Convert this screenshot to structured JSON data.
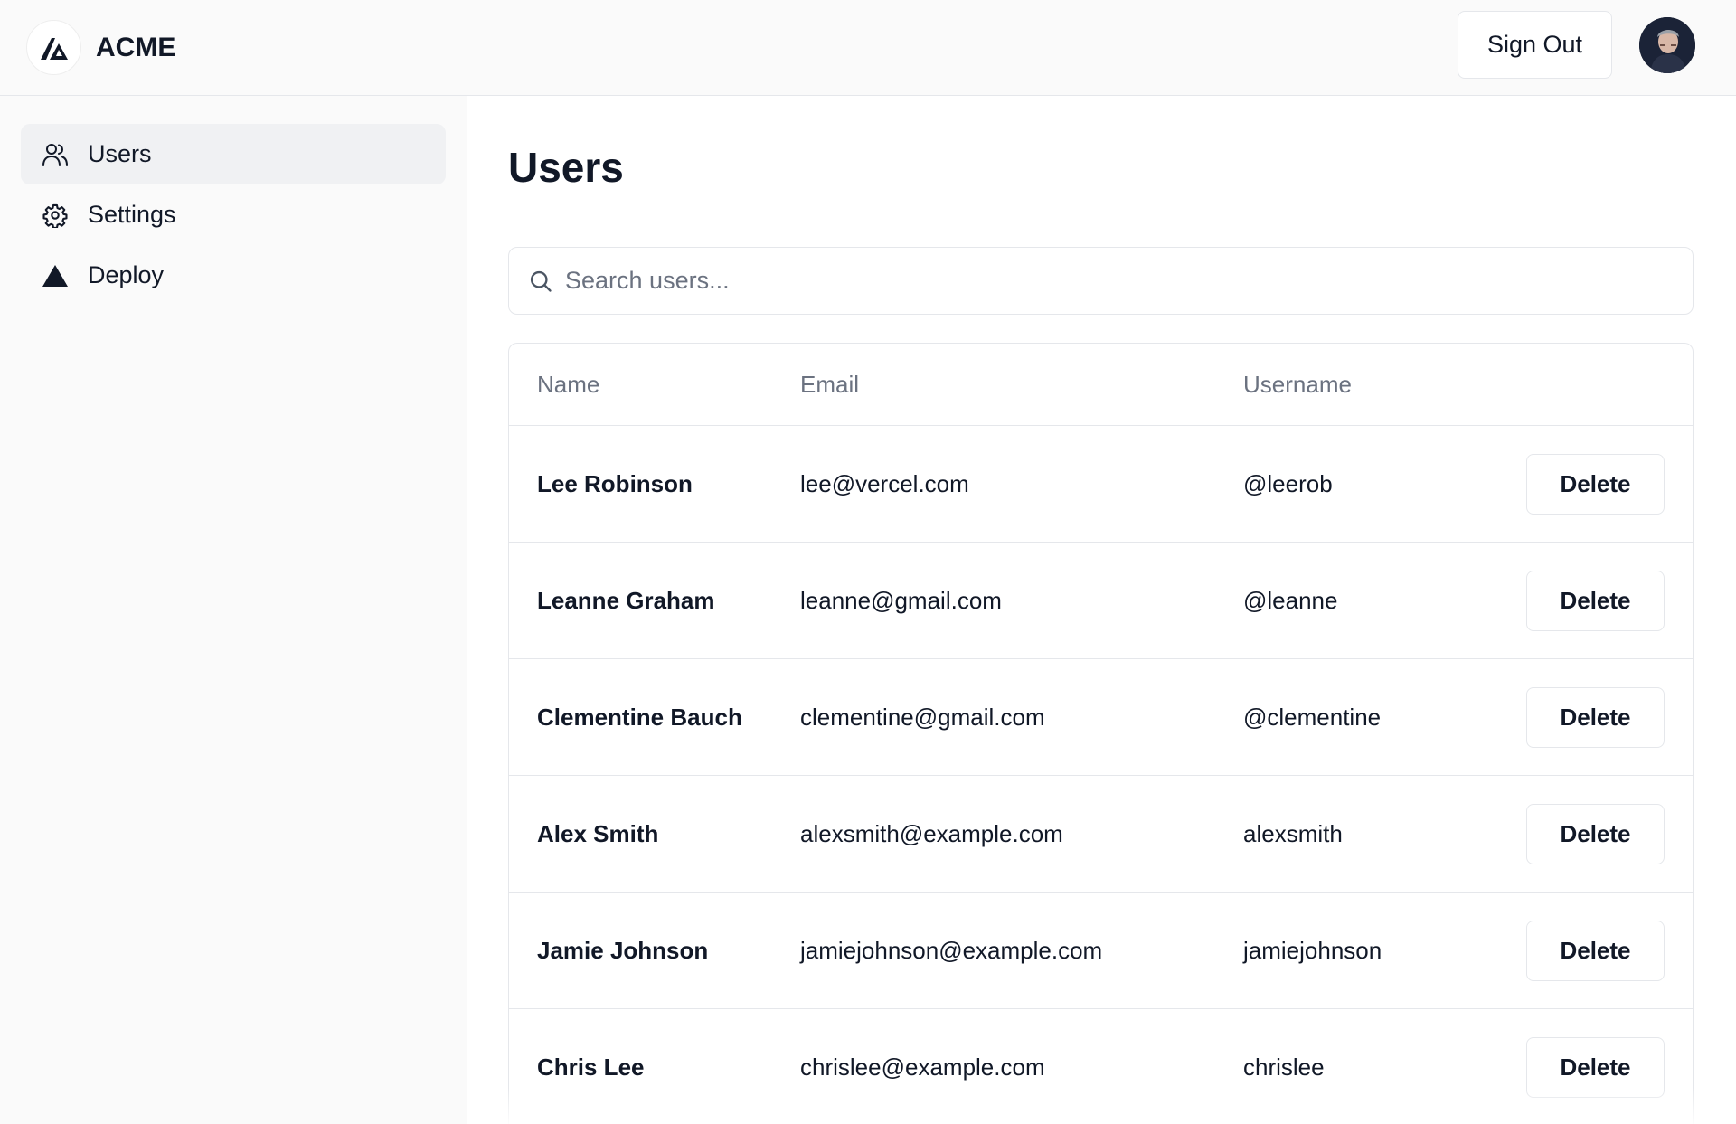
{
  "brand": {
    "name": "ACME",
    "logo_icon": "acme-logo-icon"
  },
  "sidebar": {
    "items": [
      {
        "label": "Users",
        "icon": "users-icon",
        "active": true
      },
      {
        "label": "Settings",
        "icon": "gear-icon",
        "active": false
      },
      {
        "label": "Deploy",
        "icon": "triangle-icon",
        "active": false
      }
    ]
  },
  "header": {
    "sign_out_label": "Sign Out",
    "avatar_icon": "user-avatar"
  },
  "main": {
    "title": "Users",
    "search": {
      "placeholder": "Search users...",
      "value": ""
    },
    "table": {
      "columns": [
        "Name",
        "Email",
        "Username",
        ""
      ],
      "rows": [
        {
          "name": "Lee Robinson",
          "email": "lee@vercel.com",
          "username": "@leerob",
          "action": "Delete"
        },
        {
          "name": "Leanne Graham",
          "email": "leanne@gmail.com",
          "username": "@leanne",
          "action": "Delete"
        },
        {
          "name": "Clementine Bauch",
          "email": "clementine@gmail.com",
          "username": "@clementine",
          "action": "Delete"
        },
        {
          "name": "Alex Smith",
          "email": "alexsmith@example.com",
          "username": "alexsmith",
          "action": "Delete"
        },
        {
          "name": "Jamie Johnson",
          "email": "jamiejohnson@example.com",
          "username": "jamiejohnson",
          "action": "Delete"
        },
        {
          "name": "Chris Lee",
          "email": "chrislee@example.com",
          "username": "chrislee",
          "action": "Delete"
        }
      ]
    }
  },
  "colors": {
    "text": "#111827",
    "muted": "#6b7280",
    "border": "#e5e7eb",
    "sidebar_bg": "#fafafa",
    "active_bg": "#f0f1f3"
  }
}
